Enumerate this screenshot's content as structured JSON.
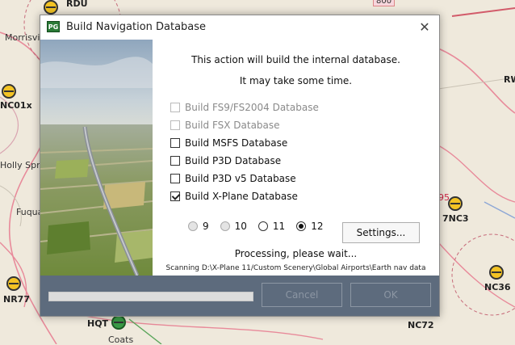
{
  "map": {
    "labels": {
      "rdu": "RDU",
      "morrisville": "Morrisvi",
      "nc01": "NC01x",
      "holly": "Holly Sprin",
      "fuquay": "Fuqua",
      "nr77": "NR77",
      "hqt": "HQT",
      "coats": "Coats",
      "rw": "RW",
      "nc3": "7NC3",
      "nc36": "NC36",
      "nc72": "NC72",
      "p95": "95",
      "top_badge": "800"
    }
  },
  "dialog": {
    "icon_text": "PG",
    "title": "Build Navigation Database",
    "close_symbol": "✕",
    "message_1": "This action will build the internal database.",
    "message_2": "It may take some time.",
    "options": [
      {
        "label": "Build FS9/FS2004 Database",
        "checked": false,
        "enabled": false
      },
      {
        "label": "Build FSX Database",
        "checked": false,
        "enabled": false
      },
      {
        "label": "Build MSFS Database",
        "checked": false,
        "enabled": true
      },
      {
        "label": "Build P3D Database",
        "checked": false,
        "enabled": true
      },
      {
        "label": "Build P3D v5 Database",
        "checked": false,
        "enabled": true
      },
      {
        "label": "Build X-Plane Database",
        "checked": true,
        "enabled": true
      }
    ],
    "xplane_versions": [
      {
        "label": "9",
        "selected": false,
        "enabled": false
      },
      {
        "label": "10",
        "selected": false,
        "enabled": false
      },
      {
        "label": "11",
        "selected": false,
        "enabled": true
      },
      {
        "label": "12",
        "selected": true,
        "enabled": true
      }
    ],
    "settings_label": "Settings...",
    "processing_text": "Processing, please wait...",
    "scanning_text": "Scanning D:\\X-Plane 11/Custom Scenery\\Global Airports\\Earth nav data",
    "progress": 0,
    "cancel_label": "Cancel",
    "ok_label": "OK"
  }
}
